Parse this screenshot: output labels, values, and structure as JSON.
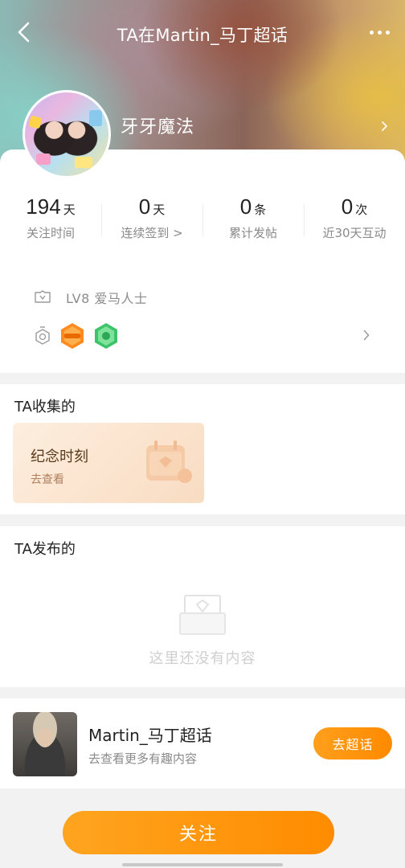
{
  "header": {
    "title": "TA在Martin_马丁超话",
    "username": "牙牙魔法"
  },
  "stats": [
    {
      "value": "194",
      "unit": "天",
      "label": "关注时间"
    },
    {
      "value": "0",
      "unit": "天",
      "label": "连续签到 >"
    },
    {
      "value": "0",
      "unit": "条",
      "label": "累计发帖"
    },
    {
      "value": "0",
      "unit": "次",
      "label": "近30天互动"
    }
  ],
  "level": {
    "text": "LV8 爱马人士"
  },
  "badges": [
    {
      "icon": "orange-hexagon-badge-icon",
      "color": "#ff8a1e"
    },
    {
      "icon": "green-hexagon-badge-icon",
      "color": "#3dc46b"
    }
  ],
  "collected": {
    "title": "TA收集的",
    "card_title": "纪念时刻",
    "card_sub": "去查看"
  },
  "posted": {
    "title": "TA发布的",
    "empty_text": "这里还没有内容"
  },
  "topic": {
    "name": "Martin_马丁超话",
    "sub": "去查看更多有趣内容",
    "go_label": "去超话"
  },
  "follow_label": "关注",
  "colors": {
    "accent": "#ff9500",
    "muted_text": "#8a8a8a"
  }
}
